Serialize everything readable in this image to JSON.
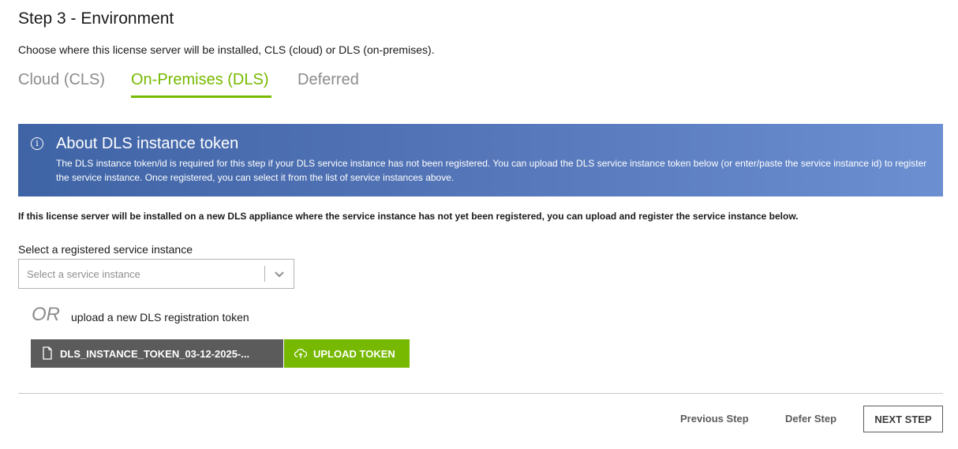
{
  "step": {
    "title": "Step 3 - Environment",
    "description": "Choose where this license server will be installed, CLS (cloud) or DLS (on-premises)."
  },
  "tabs": [
    {
      "label": "Cloud (CLS)",
      "active": false
    },
    {
      "label": "On-Premises (DLS)",
      "active": true
    },
    {
      "label": "Deferred",
      "active": false
    }
  ],
  "info": {
    "icon": "info-icon",
    "icon_glyph": "i",
    "title": "About DLS instance token",
    "body": "The DLS instance token/id is required for this step if your DLS service instance has not been registered. You can upload the DLS service instance token below (or enter/paste the service instance id) to register the service instance. Once registered, you can select it from the list of service instances above."
  },
  "note": "If this license server will be installed on a new DLS appliance where the service instance has not yet been registered, you can upload and register the service instance below.",
  "select": {
    "label": "Select a registered service instance",
    "placeholder": "Select a service instance"
  },
  "or": {
    "text": "OR",
    "description": "upload a new DLS registration token"
  },
  "file": {
    "name": "DLS_INSTANCE_TOKEN_03-12-2025-..."
  },
  "upload": {
    "label": "UPLOAD TOKEN"
  },
  "footer": {
    "previous": "Previous Step",
    "defer": "Defer Step",
    "next": "NEXT STEP"
  },
  "colors": {
    "accent": "#76b900",
    "banner_start": "#3f64a6",
    "banner_end": "#6b8fd1",
    "file_bg": "#5b5b5b"
  }
}
